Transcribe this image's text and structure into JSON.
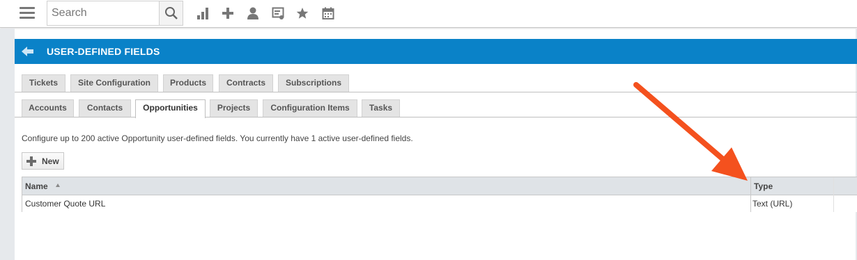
{
  "topbar": {
    "search_placeholder": "Search",
    "icons": [
      "hamburger-menu-icon",
      "search-icon",
      "reports-icon",
      "add-icon",
      "user-icon",
      "ticket-icon",
      "star-icon",
      "calendar-icon"
    ]
  },
  "header": {
    "title": "USER-DEFINED FIELDS",
    "accent_color": "#0a82c8"
  },
  "tabs_row1": [
    "Tickets",
    "Site Configuration",
    "Products",
    "Contracts",
    "Subscriptions"
  ],
  "tabs_row2": [
    "Accounts",
    "Contacts",
    "Opportunities",
    "Projects",
    "Configuration Items",
    "Tasks"
  ],
  "active_tab": "Opportunities",
  "description": "Configure up to 200 active Opportunity user-defined fields. You currently have 1 active user-defined fields.",
  "new_button": "New",
  "grid": {
    "columns": [
      "Name",
      "Type"
    ],
    "sort": "Name ascending",
    "rows": [
      {
        "name": "Customer Quote URL",
        "type": "Text (URL)"
      }
    ]
  },
  "annotation_arrow_color": "#f4511e"
}
